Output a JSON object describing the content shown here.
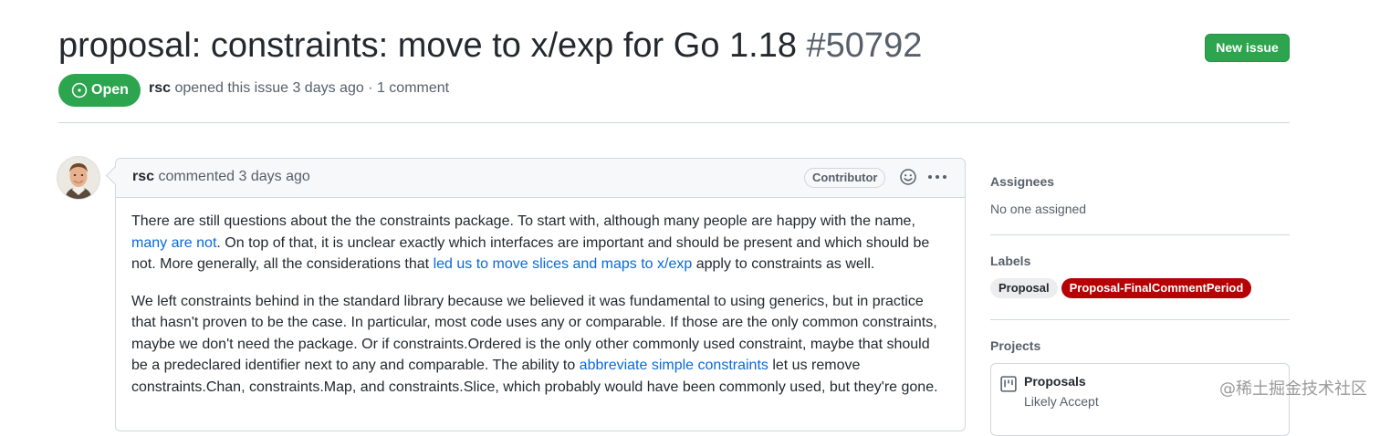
{
  "issue": {
    "title": "proposal: constraints: move to x/exp for Go 1.18",
    "number": "#50792",
    "state": "Open",
    "author": "rsc",
    "opened_text": "opened this issue 3 days ago · 1 comment"
  },
  "header": {
    "new_issue_label": "New issue"
  },
  "comment": {
    "author": "rsc",
    "meta": "commented 3 days ago",
    "badge": "Contributor",
    "paragraph1": {
      "l1": "There are still questions about the the constraints package. To start with, although many people are happy with the name,",
      "l2_link": "many are not",
      "l2_rest": ". On top of that, it is unclear exactly which interfaces are important and should be present and which should be",
      "l3_a": "not. More generally, all the considerations that ",
      "l3_link": "led us to move slices and maps to x/exp",
      "l3_b": " apply to constraints as well."
    },
    "paragraph2": {
      "l1": "We left constraints behind in the standard library because we believed it was fundamental to using generics, but in practice",
      "l2": "that hasn't proven to be the case. In particular, most code uses any or comparable. If those are the only common constraints,",
      "l3": "maybe we don't need the package. Or if constraints.Ordered is the only other commonly used constraint, maybe that should",
      "l4_a": "be a predeclared identifier next to any and comparable. The ability to ",
      "l4_link": "abbreviate simple constraints",
      "l4_b": " let us remove",
      "l5": "constraints.Chan, constraints.Map, and constraints.Slice, which probably would have been commonly used, but they're gone."
    }
  },
  "sidebar": {
    "assignees": {
      "heading": "Assignees",
      "value": "No one assigned"
    },
    "labels": {
      "heading": "Labels",
      "items": [
        {
          "name": "Proposal",
          "bg": "#ededed",
          "fg": "#24292f"
        },
        {
          "name": "Proposal-FinalCommentPeriod",
          "bg": "#b60205",
          "fg": "#ffffff"
        }
      ]
    },
    "projects": {
      "heading": "Projects",
      "name": "Proposals",
      "status": "Likely Accept"
    }
  },
  "watermark": "@稀土掘金技术社区",
  "colors": {
    "open_green": "#2da44e",
    "link": "#0969da"
  }
}
